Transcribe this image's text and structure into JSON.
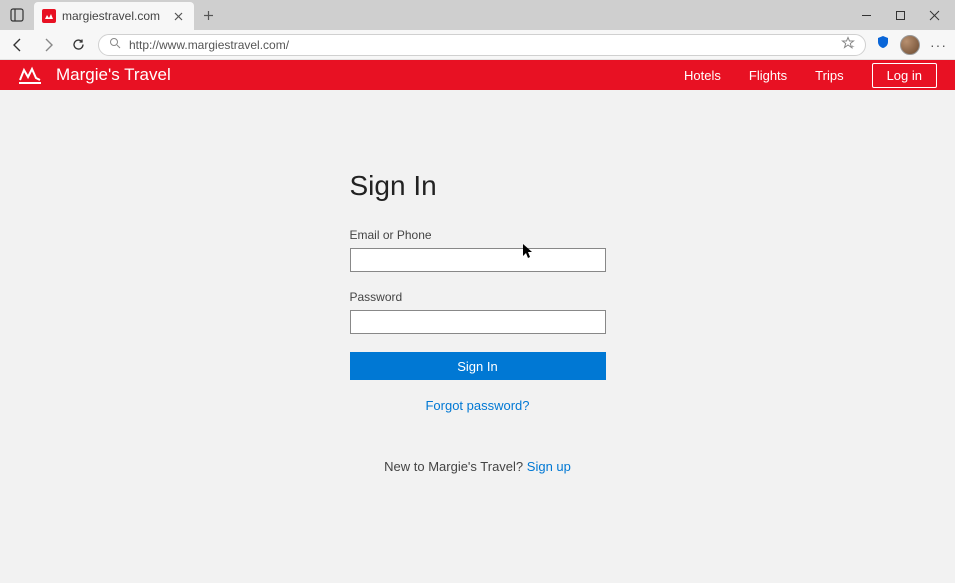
{
  "browser": {
    "tab_title": "margiestravel.com",
    "url": "http://www.margiestravel.com/"
  },
  "header": {
    "site_title": "Margie's Travel",
    "nav": {
      "hotels": "Hotels",
      "flights": "Flights",
      "trips": "Trips",
      "login": "Log in"
    }
  },
  "form": {
    "title": "Sign In",
    "email_label": "Email or Phone",
    "email_value": "",
    "password_label": "Password",
    "password_value": "",
    "submit_label": "Sign In",
    "forgot_text": "Forgot password?",
    "signup_prompt": "New to Margie's Travel? ",
    "signup_link": "Sign up"
  }
}
